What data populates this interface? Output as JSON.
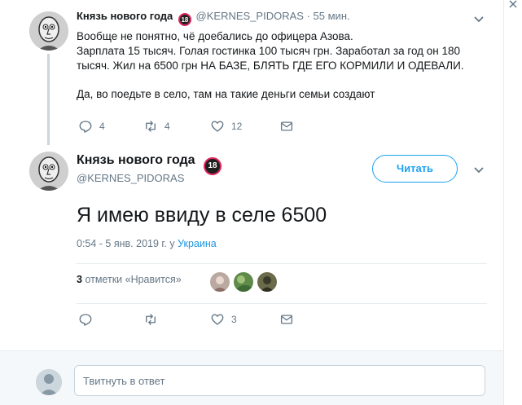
{
  "parent_tweet": {
    "display_name": "Князь нового года",
    "badge": "18",
    "handle": "@KERNES_PIDORAS",
    "separator": "·",
    "time": "55 мин.",
    "text_lines": [
      "Вообще не понятно, чё доебались до офицера Азова.",
      "Зарплата 15 тысяч. Голая гостинка 100 тысяч грн. Заработал за год он 180",
      "тысяч. Жил на 6500 грн НА БАЗЕ, БЛЯТЬ ГДЕ ЕГО КОРМИЛИ И ОДЕВАЛИ."
    ],
    "text_last": "Да, во поедьте в село, там на такие деньги семьи создают",
    "replies": "4",
    "retweets": "4",
    "likes": "12"
  },
  "main_tweet": {
    "display_name": "Князь нового года",
    "badge": "18",
    "handle": "@KERNES_PIDORAS",
    "follow_label": "Читать",
    "text": "Я имею ввиду в селе 6500",
    "timestamp": "0:54 - 5 янв. 2019 г.",
    "location_prefix": "Украина",
    "likes_count": "3",
    "likes_label": "отметки «Нравится»",
    "action_likes": "3"
  },
  "reply_box": {
    "placeholder": "Твитнуть в ответ"
  },
  "icons": {
    "reply": "reply-icon",
    "retweet": "retweet-icon",
    "like": "heart-icon",
    "dm": "envelope-icon",
    "more": "chevron-down-icon"
  },
  "colors": {
    "accent": "#1da1f2",
    "link": "#1b95e0",
    "muted": "#657786",
    "badge_ring": "#e0245e"
  }
}
